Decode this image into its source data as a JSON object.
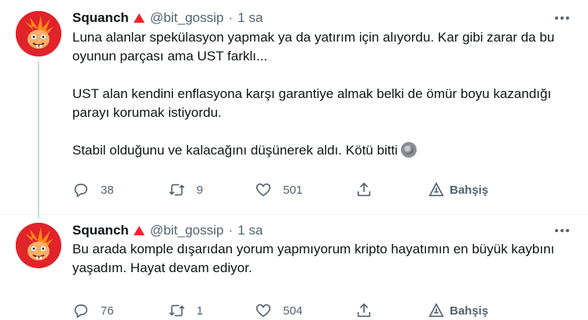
{
  "tweets": [
    {
      "author_name": "Squanch",
      "handle": "@bit_gossip",
      "separator": "·",
      "time": "1 sa",
      "paragraphs": [
        "Luna alanlar spekülasyon yapmak ya da yatırım için alıyordu. Kar gibi zarar da bu oyunun parçası ama UST farklı...",
        "UST alan kendini enflasyona karşı garantiye almak belki de ömür boyu kazandığı parayı korumak istiyordu.",
        "Stabil olduğunu ve kalacağını düşünerek aldı. Kötü bitti"
      ],
      "emoji": "new-moon-face",
      "replies": "38",
      "retweets": "9",
      "likes": "501",
      "tip_label": "Bahşiş"
    },
    {
      "author_name": "Squanch",
      "handle": "@bit_gossip",
      "separator": "·",
      "time": "1 sa",
      "paragraphs": [
        "Bu arada komple dışarıdan yorum yapmıyorum kripto hayatımın en büyük kaybını yaşadım. Hayat devam ediyor."
      ],
      "replies": "76",
      "retweets": "1",
      "likes": "504",
      "tip_label": "Bahşiş"
    }
  ],
  "colors": {
    "avatar_bg": "#e0242a",
    "verified_badge": "#f4212e",
    "secondary_text": "#536471",
    "thread_line": "#cfd9de"
  }
}
